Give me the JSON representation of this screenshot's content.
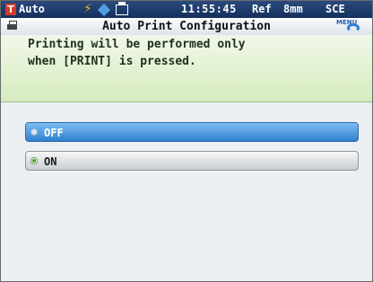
{
  "status": {
    "mode": "Auto",
    "mode_badge": "T",
    "time": "11:55:45",
    "ref": "Ref",
    "area": "8mm",
    "spec": "SCE"
  },
  "header": {
    "title": "Auto Print Configuration",
    "menu_label": "MENU"
  },
  "message": {
    "line1": "Printing will be performed only",
    "line2": "when [PRINT] is pressed."
  },
  "options": [
    {
      "label": "OFF",
      "state": "highlighted"
    },
    {
      "label": "ON",
      "state": "selected"
    }
  ],
  "colors": {
    "highlight": "#2f80d0",
    "message_bg": "#d6ecbf",
    "statusbar_bg": "#1a3a6e"
  }
}
